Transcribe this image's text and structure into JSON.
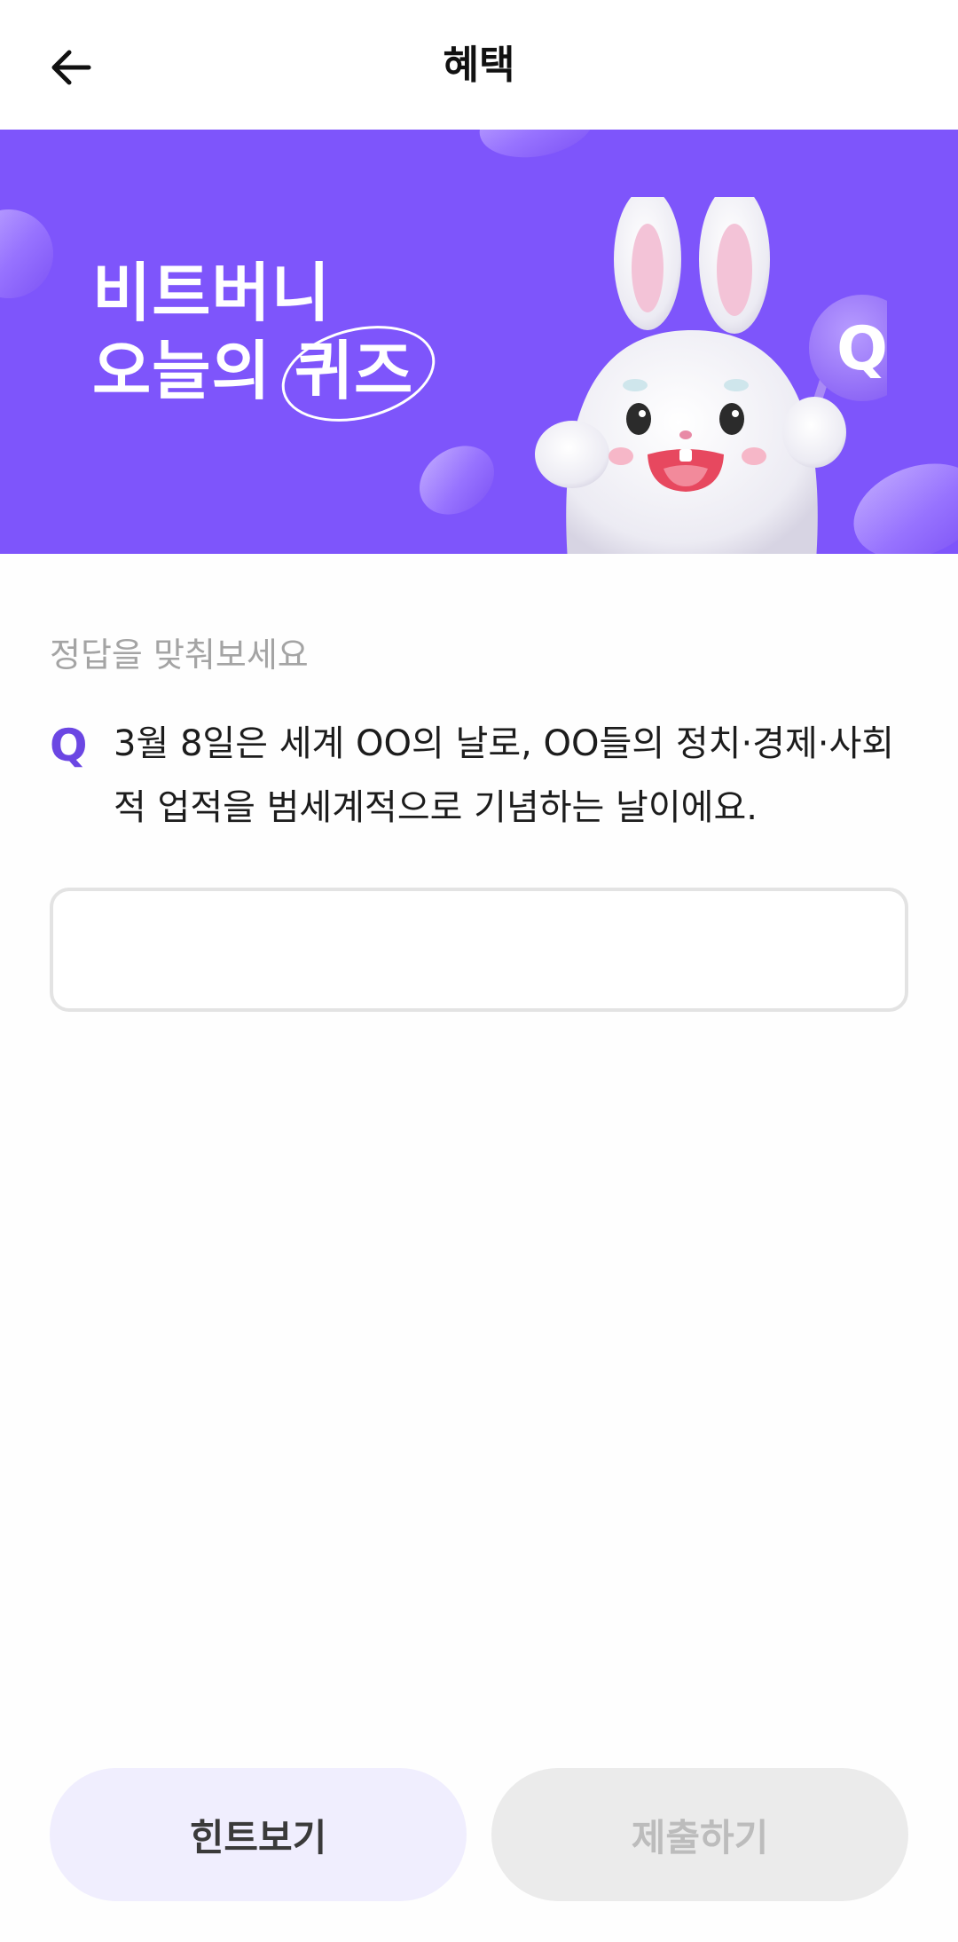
{
  "header": {
    "title": "혜택",
    "back_icon": "arrow-left-icon"
  },
  "banner": {
    "title_line1": "비트버니",
    "title_line2_prefix": "오늘의",
    "title_line2_highlight": "퀴즈",
    "background_color": "#7e55fb",
    "badge_letter": "Q"
  },
  "quiz": {
    "prompt": "정답을 맞춰보세요",
    "q_mark": "Q",
    "question": "3월 8일은 세계 OO의 날로, OO들의 정치·경제·사회적 업적을 범세계적으로 기념하는 날이에요.",
    "answer_value": "",
    "answer_placeholder": ""
  },
  "buttons": {
    "hint_label": "힌트보기",
    "submit_label": "제출하기"
  },
  "colors": {
    "accent": "#6b46e3",
    "hint_bg": "#f0eefe",
    "submit_disabled_bg": "#ebebeb"
  }
}
